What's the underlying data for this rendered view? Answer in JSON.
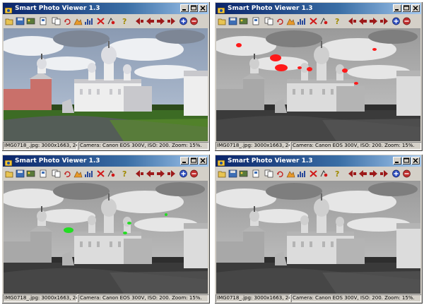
{
  "windows": [
    {
      "title": "Smart Photo Viewer 1.3",
      "mode": "color",
      "status": {
        "file_info": "IMG0718_.jpg: 3000x1663, 24bpp",
        "camera_info": "Camera: Canon EOS 300V, ISO: 200. Zoom: 15%."
      }
    },
    {
      "title": "Smart Photo Viewer 1.3",
      "mode": "gray-red-highlights",
      "status": {
        "file_info": "IMG0718_.jpg: 3000x1663, 24bpp",
        "camera_info": "Camera: Canon EOS 300V, ISO: 200. Zoom: 15%."
      }
    },
    {
      "title": "Smart Photo Viewer 1.3",
      "mode": "gray-green-highlights",
      "status": {
        "file_info": "IMG0718_.jpg: 3000x1663, 24bpp",
        "camera_info": "Camera: Canon EOS 300V, ISO: 200. Zoom: 15%."
      }
    },
    {
      "title": "Smart Photo Viewer 1.3",
      "mode": "grayscale",
      "status": {
        "file_info": "IMG0718_.jpg: 3000x1663, 24bpp",
        "camera_info": "Camera: Canon EOS 300V, ISO: 200. Zoom: 15%."
      }
    }
  ],
  "toolbar_icons": [
    "open-folder-icon",
    "save-icon",
    "slideshow-icon",
    "properties-icon",
    "copy-icon",
    "rotate-icon",
    "levels-icon",
    "histogram-icon",
    "delete-icon",
    "red-eye-icon",
    "help-icon",
    "first-icon",
    "previous-icon",
    "next-icon",
    "last-icon",
    "zoom-in-icon",
    "zoom-out-icon"
  ],
  "colors": {
    "title_bar": "#0a246a",
    "title_bar_end": "#a6caf0",
    "window_face": "#d4d0c8",
    "highlight_red": "#ff1a1a",
    "highlight_green": "#22dd22",
    "toolbar_arrow": "#9c1a1a"
  }
}
